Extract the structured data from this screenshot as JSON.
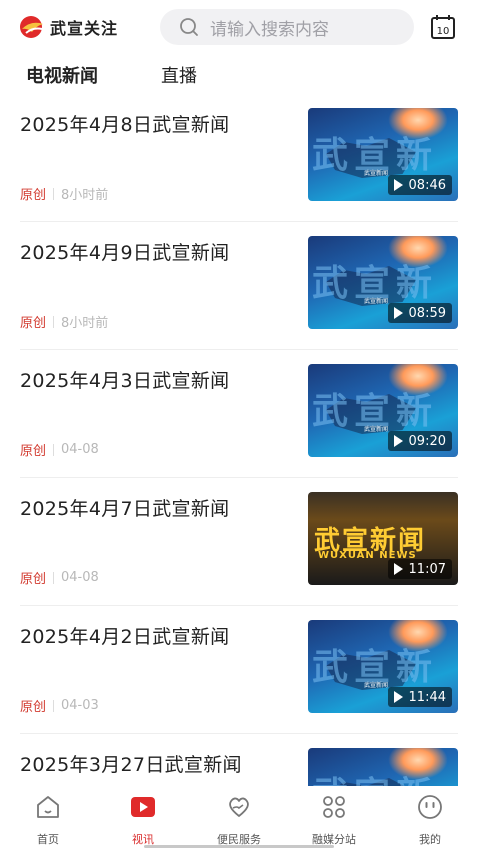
{
  "header": {
    "app_name": "武宣关注",
    "search_placeholder": "请输入搜索内容",
    "calendar_day": "10"
  },
  "tabs": [
    {
      "label": "电视新闻",
      "active": true
    },
    {
      "label": "直播",
      "active": false
    }
  ],
  "news": [
    {
      "title": "2025年4月8日武宣新闻",
      "source": "原创",
      "time": "8小时前",
      "duration": "08:46",
      "thumb": "blue"
    },
    {
      "title": "2025年4月9日武宣新闻",
      "source": "原创",
      "time": "8小时前",
      "duration": "08:59",
      "thumb": "blue"
    },
    {
      "title": "2025年4月3日武宣新闻",
      "source": "原创",
      "time": "04-08",
      "duration": "09:20",
      "thumb": "blue"
    },
    {
      "title": "2025年4月7日武宣新闻",
      "source": "原创",
      "time": "04-08",
      "duration": "11:07",
      "thumb": "gold"
    },
    {
      "title": "2025年4月2日武宣新闻",
      "source": "原创",
      "time": "04-03",
      "duration": "11:44",
      "thumb": "blue"
    },
    {
      "title": "2025年3月27日武宣新闻",
      "source": "",
      "time": "",
      "duration": "",
      "thumb": "blue"
    }
  ],
  "thumb_text": {
    "blue_overlay": "武宣新",
    "blue_sub": "武宣新闻",
    "gold_overlay": "武宣新闻",
    "gold_en": "WUXUAN NEWS"
  },
  "bottom_nav": [
    {
      "label": "首页",
      "icon": "home-icon",
      "active": false
    },
    {
      "label": "视讯",
      "icon": "video-play-icon",
      "active": true
    },
    {
      "label": "便民服务",
      "icon": "heart-hand-icon",
      "active": false
    },
    {
      "label": "融媒分站",
      "icon": "grid-icon",
      "active": false
    },
    {
      "label": "我的",
      "icon": "smile-face-icon",
      "active": false
    }
  ],
  "colors": {
    "accent": "#d92b2b",
    "source_red": "#d23a2f"
  }
}
